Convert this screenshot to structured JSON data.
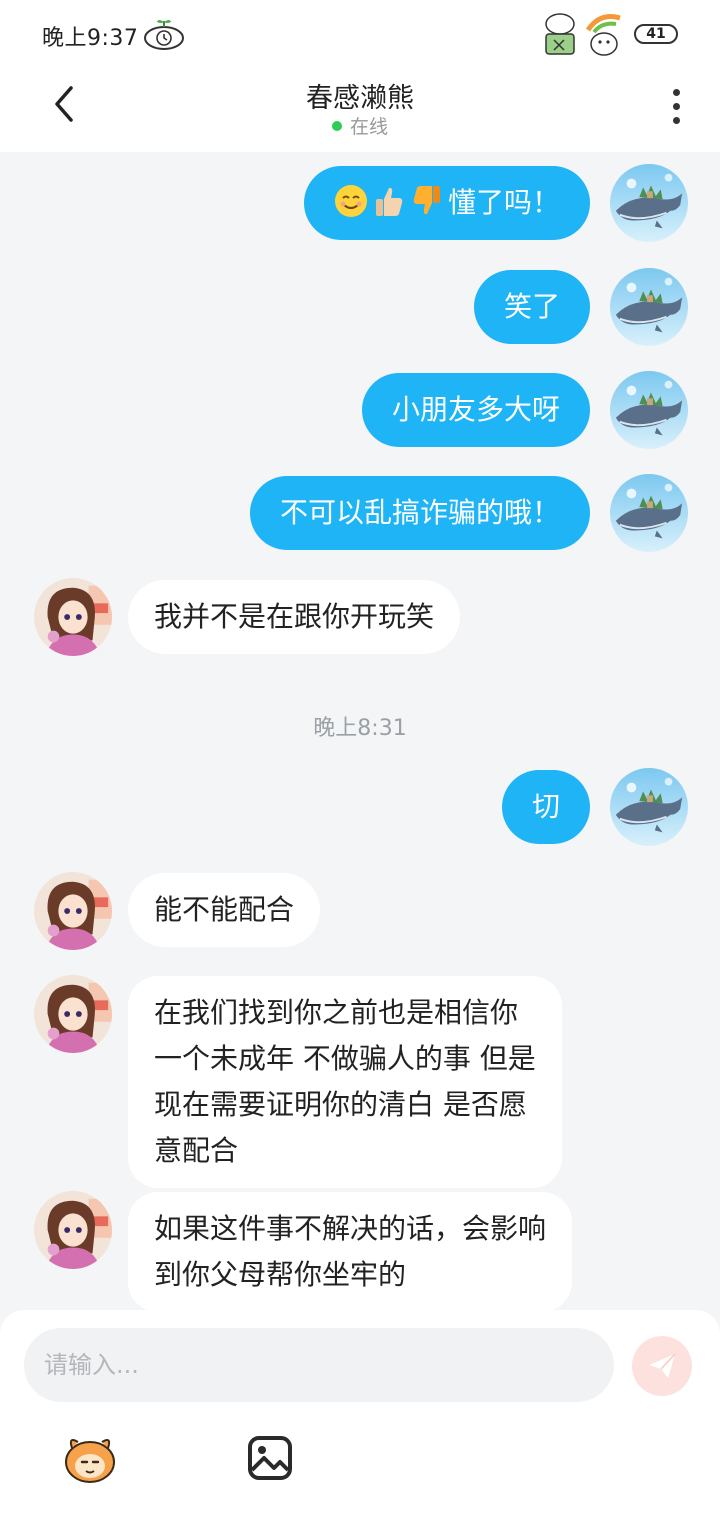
{
  "status_bar": {
    "time": "晚上9:37",
    "battery": "41"
  },
  "header": {
    "contact_name": "春感濑熊",
    "status": "在线"
  },
  "messages": [
    {
      "side": "out",
      "text": "懂了吗！",
      "emojis": [
        "smiling-face-emoji",
        "thumbs-up-emoji",
        "thumbs-down-emoji"
      ]
    },
    {
      "side": "out",
      "text": "笑了"
    },
    {
      "side": "out",
      "text": "小朋友多大呀"
    },
    {
      "side": "out",
      "text": "不可以乱搞诈骗的哦！"
    },
    {
      "side": "in",
      "text": "我并不是在跟你开玩笑"
    },
    {
      "side": "out",
      "text": "切"
    },
    {
      "side": "in",
      "text": "能不能配合"
    },
    {
      "side": "in",
      "lines": [
        "在我们找到你之前也是相信你",
        "一个未成年 不做骗人的事 但是",
        "现在需要证明你的清白 是否愿",
        "意配合"
      ]
    },
    {
      "side": "in",
      "lines": [
        "如果这件事不解决的话，会影响",
        "到你父母帮你坐牢的"
      ]
    }
  ],
  "timestamp": "晚上8:31",
  "input": {
    "placeholder": "请输入..."
  },
  "colors": {
    "outgoing_bubble": "#1fb4f5",
    "incoming_bubble": "#ffffff",
    "background": "#f4f5f7",
    "online": "#2ecc55",
    "send_button": "#fde1df"
  }
}
